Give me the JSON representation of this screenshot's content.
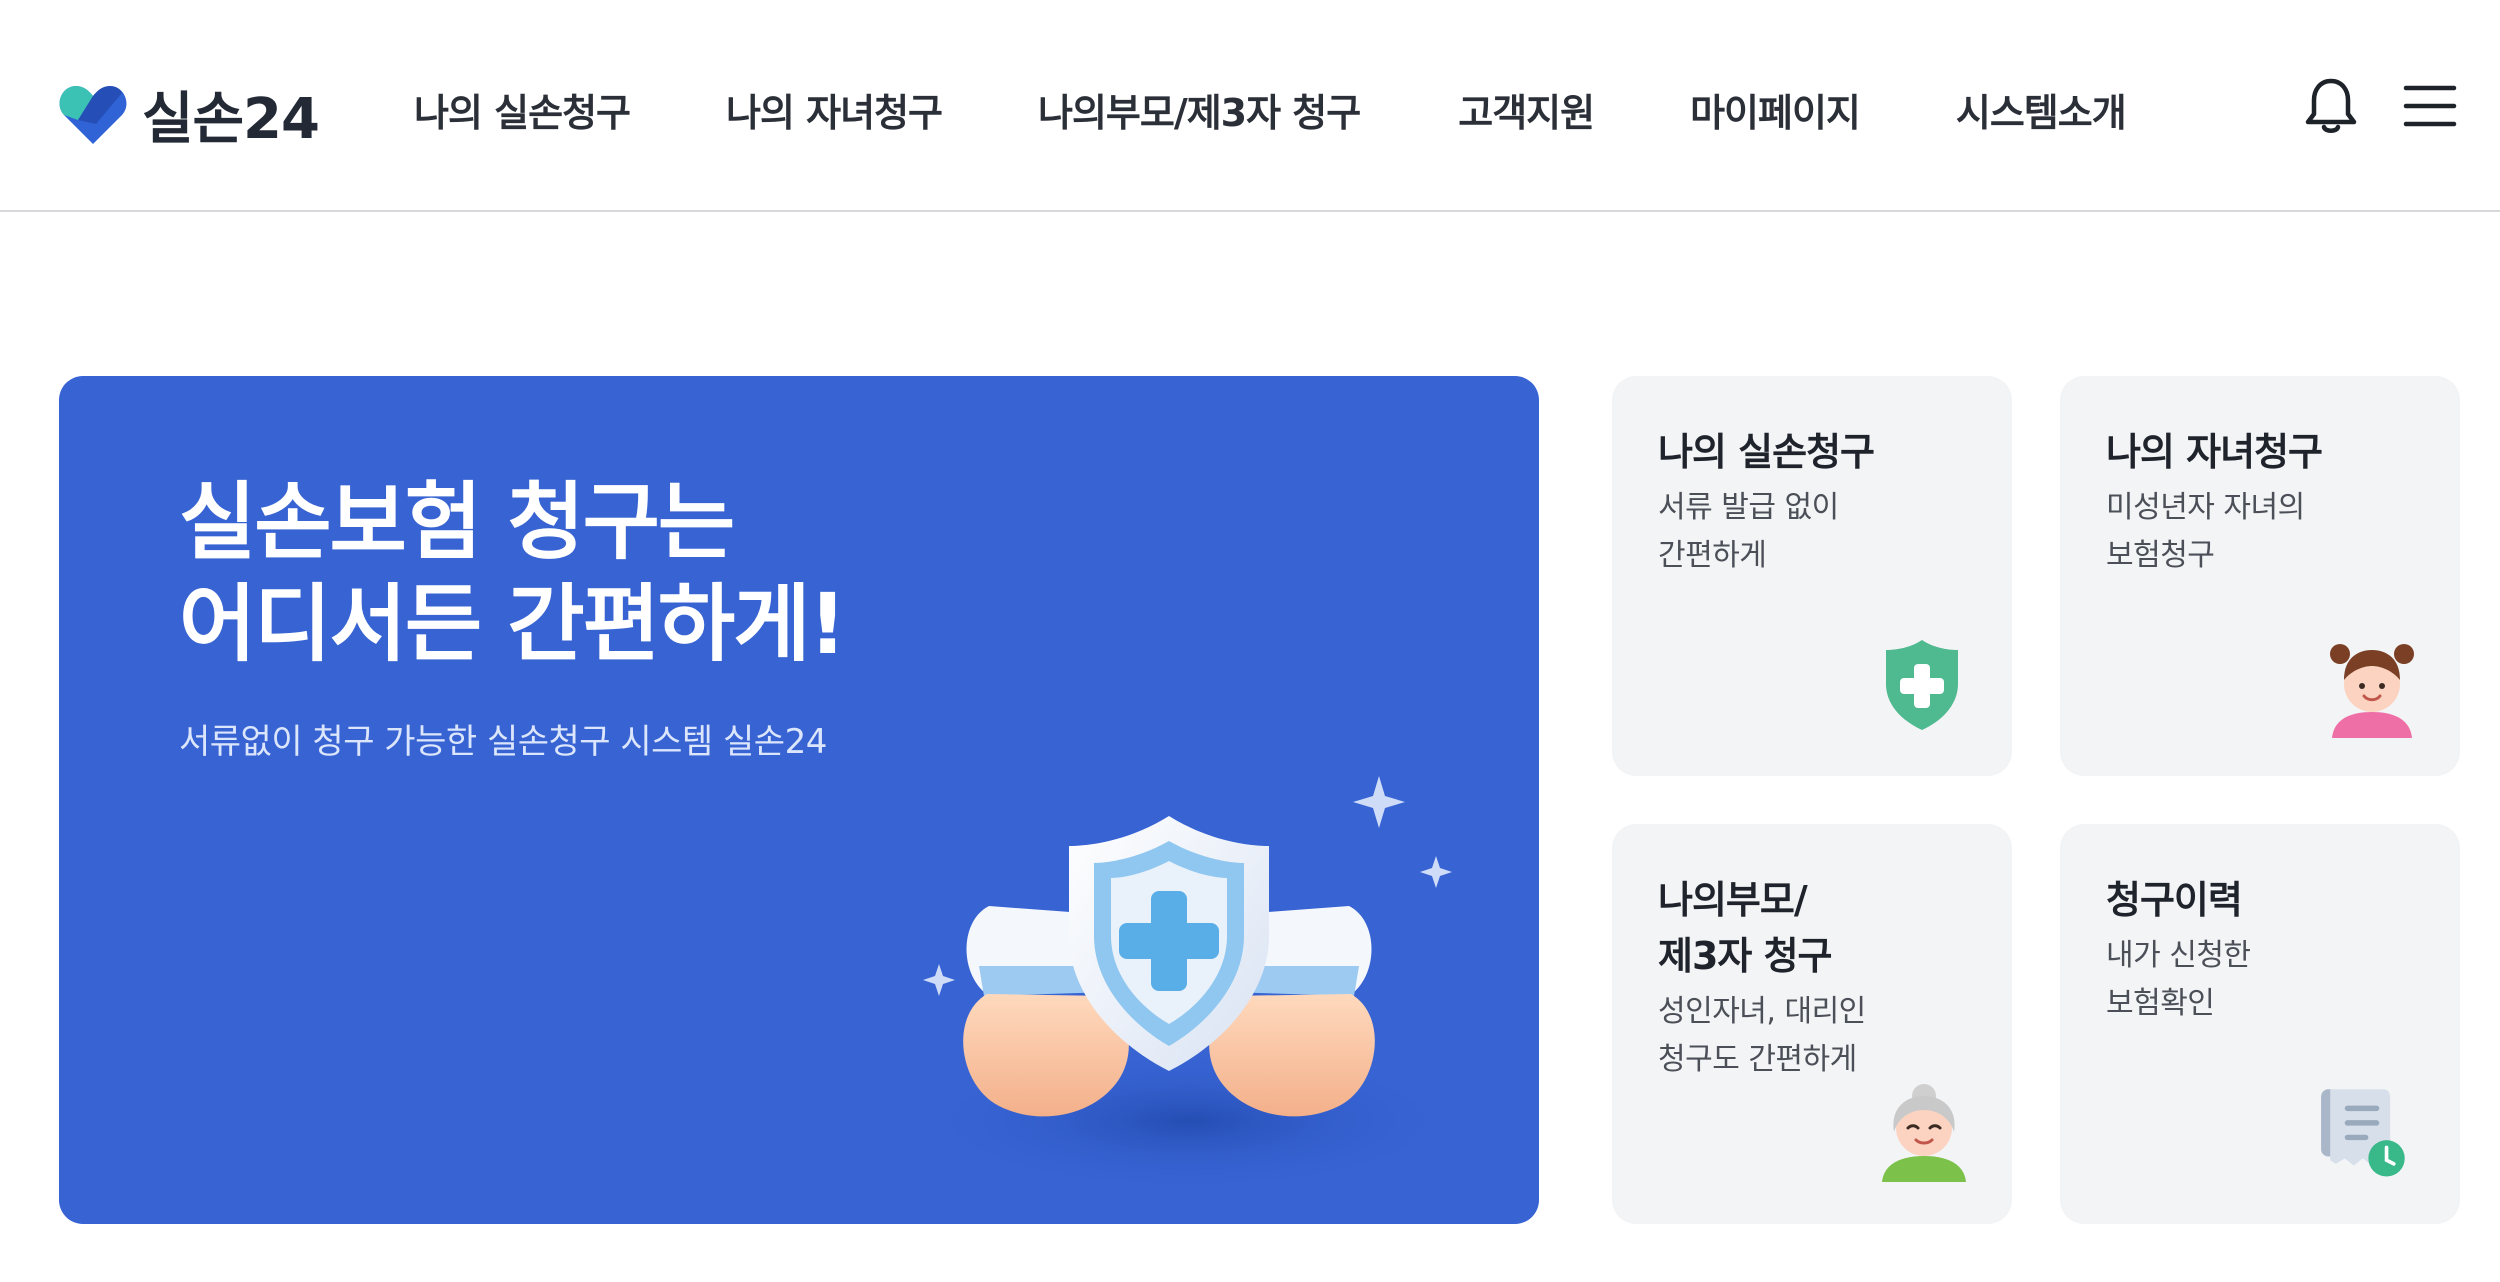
{
  "header": {
    "logo_text": "실손24",
    "nav": [
      "나의 실손청구",
      "나의 자녀청구",
      "나의부모/제3자 청구",
      "고객지원",
      "마이페이지",
      "시스템소개"
    ],
    "icons": [
      "bell-icon",
      "hamburger-menu-icon"
    ]
  },
  "hero": {
    "title_line1": "실손보험 청구는",
    "title_line2": "어디서든 간편하게!",
    "subtitle": "서류없이 청구 가능한 실손청구 시스템 실손24",
    "background_color": "#3763d3",
    "illustration": "hands-holding-shield-icon"
  },
  "cards": [
    {
      "title_lines": [
        "나의 실손청구"
      ],
      "desc_lines": [
        "서류 발급 없이",
        "간편하게"
      ],
      "icon": "green-shield-plus-icon"
    },
    {
      "title_lines": [
        "나의 자녀청구"
      ],
      "desc_lines": [
        "미성년자 자녀의",
        "보험청구"
      ],
      "icon": "girl-avatar-icon"
    },
    {
      "title_lines": [
        "나의부모/",
        "제3자 청구"
      ],
      "desc_lines": [
        "성인자녀, 대리인",
        "청구도 간편하게"
      ],
      "icon": "grandma-avatar-icon"
    },
    {
      "title_lines": [
        "청구이력"
      ],
      "desc_lines": [
        "내가 신청한",
        "보험확인"
      ],
      "icon": "receipt-clock-icon"
    }
  ],
  "colors": {
    "brand_blue": "#3763d3",
    "card_bg": "#f3f4f6",
    "accent_green": "#4fb98f"
  }
}
